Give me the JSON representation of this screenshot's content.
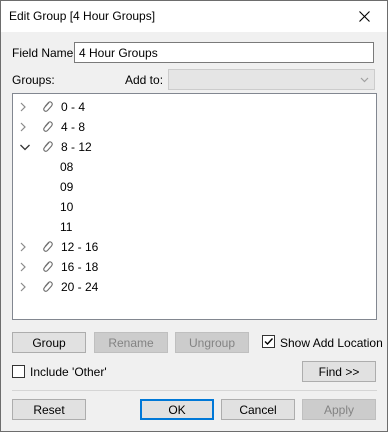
{
  "window": {
    "title": "Edit Group [4 Hour Groups]"
  },
  "field_name": {
    "label": "Field Name:",
    "value": "4 Hour Groups"
  },
  "groups_label": "Groups:",
  "add_to": {
    "label": "Add to:",
    "value": ""
  },
  "tree": {
    "groups": [
      {
        "label": "0 - 4",
        "expanded": false
      },
      {
        "label": "4 - 8",
        "expanded": false
      },
      {
        "label": "8 - 12",
        "expanded": true,
        "members": [
          "08",
          "09",
          "10",
          "11"
        ]
      },
      {
        "label": "12 - 16",
        "expanded": false
      },
      {
        "label": "16 - 18",
        "expanded": false
      },
      {
        "label": "20 - 24",
        "expanded": false
      }
    ]
  },
  "buttons": {
    "group": "Group",
    "rename": "Rename",
    "ungroup": "Ungroup",
    "find": "Find >>",
    "reset": "Reset",
    "ok": "OK",
    "cancel": "Cancel",
    "apply": "Apply"
  },
  "show_add_location": {
    "label": "Show Add Location",
    "checked": true
  },
  "include_other": {
    "label": "Include 'Other'",
    "checked": false
  },
  "colors": {
    "focus_border": "#0078d7",
    "disabled_bg": "#cccccc",
    "dialog_bg": "#f0f0f0"
  }
}
